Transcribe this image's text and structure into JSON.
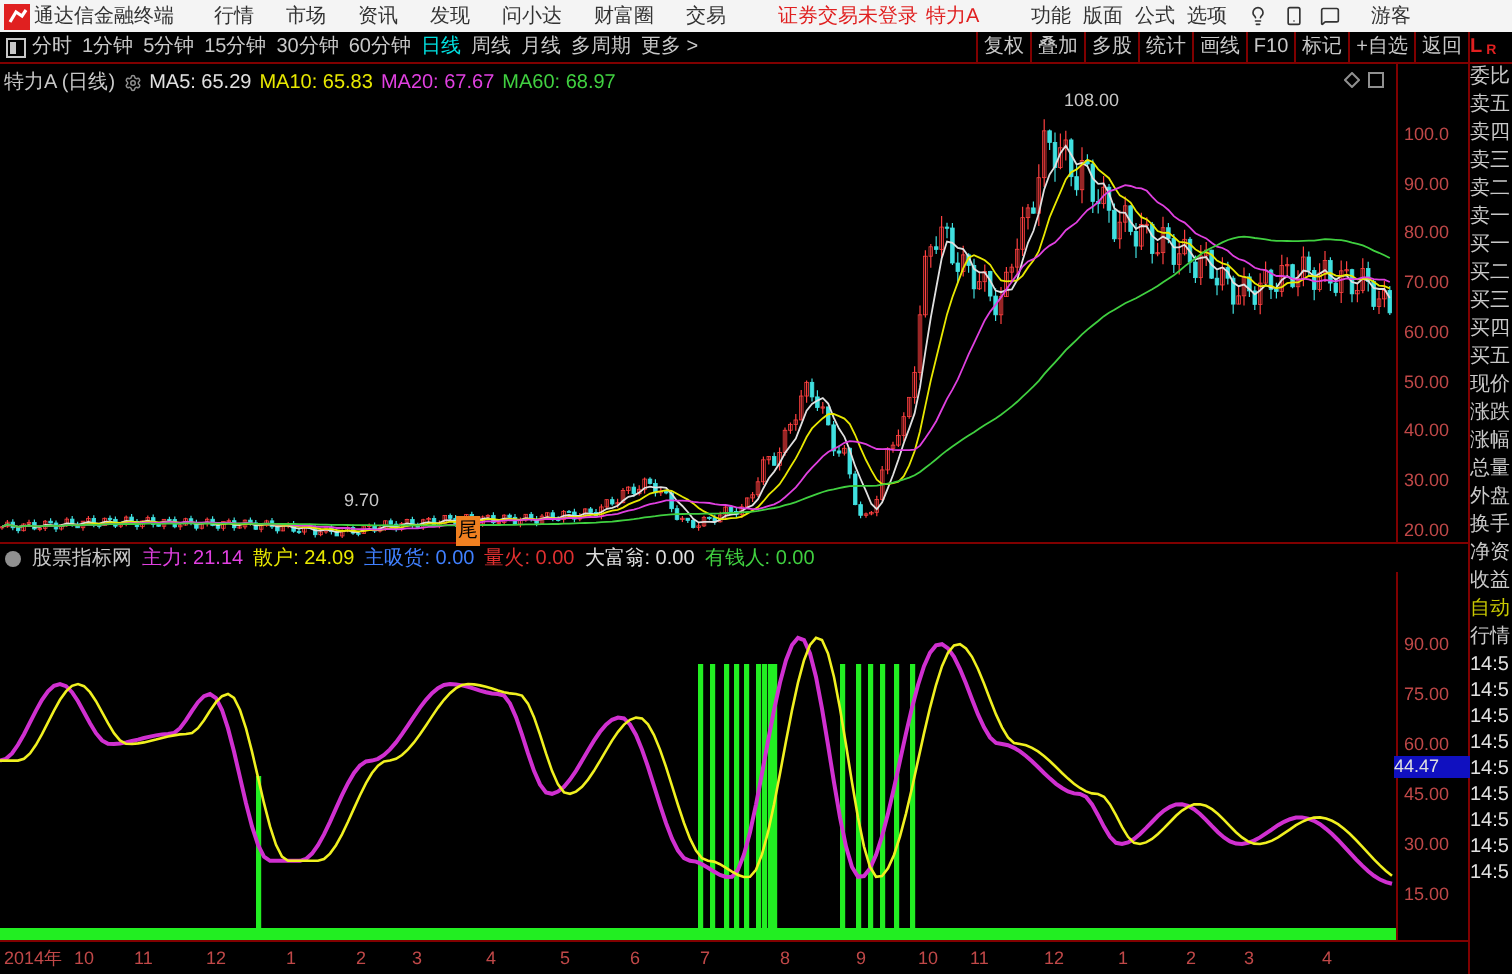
{
  "menu_bar": {
    "app_title": "通达信金融终端",
    "menus": [
      "行情",
      "市场",
      "资讯",
      "发现",
      "问小达",
      "财富圈",
      "交易"
    ],
    "login_status": "证券交易未登录",
    "stock": "特力A",
    "tools": [
      "功能",
      "版面",
      "公式",
      "选项"
    ],
    "user": "游客"
  },
  "period_tabs": [
    {
      "label": "分时",
      "selected": false
    },
    {
      "label": "1分钟",
      "selected": false
    },
    {
      "label": "5分钟",
      "selected": false
    },
    {
      "label": "15分钟",
      "selected": false
    },
    {
      "label": "30分钟",
      "selected": false
    },
    {
      "label": "60分钟",
      "selected": false
    },
    {
      "label": "日线",
      "selected": true
    },
    {
      "label": "周线",
      "selected": false
    },
    {
      "label": "月线",
      "selected": false
    },
    {
      "label": "多周期",
      "selected": false
    },
    {
      "label": "更多 >",
      "selected": false
    }
  ],
  "chart_tools": [
    "复权",
    "叠加",
    "多股",
    "统计",
    "画线",
    "F10",
    "标记",
    "+自选",
    "返回"
  ],
  "main_chart": {
    "title": "特力A (日线)",
    "indicators": [
      {
        "label": "MA5: 65.29",
        "color": "#e0e0e0"
      },
      {
        "label": "MA10: 65.83",
        "color": "#e8e800"
      },
      {
        "label": "MA20: 67.67",
        "color": "#e040e0"
      },
      {
        "label": "MA60: 68.97",
        "color": "#40d040"
      }
    ],
    "high_label": "108.00",
    "low_label": "9.70",
    "marker": "尾",
    "price_axis": [
      "100.0",
      "90.00",
      "80.00",
      "70.00",
      "60.00",
      "50.00",
      "40.00",
      "30.00",
      "20.00"
    ]
  },
  "indicator_panel": {
    "title": "股票指标网",
    "values": [
      {
        "label": "主力: 21.14",
        "color": "#e040e0"
      },
      {
        "label": "散户: 24.09",
        "color": "#e8e800"
      },
      {
        "label": "主吸货: 0.00",
        "color": "#4080ff"
      },
      {
        "label": "量火: 0.00",
        "color": "#e03030"
      },
      {
        "label": "大富翁: 0.00",
        "color": "#e0e0e0"
      },
      {
        "label": "有钱人: 0.00",
        "color": "#40d040"
      }
    ],
    "axis": [
      "90.00",
      "75.00",
      "60.00",
      "45.00",
      "30.00",
      "15.00"
    ],
    "current_value": "44.47"
  },
  "time_axis": [
    "2014年",
    "10",
    "11",
    "12",
    "1",
    "2",
    "3",
    "4",
    "5",
    "6",
    "7",
    "8",
    "9",
    "10",
    "11",
    "12",
    "1",
    "2",
    "3",
    "4"
  ],
  "side_panel": {
    "header": [
      "L",
      "R"
    ],
    "rows": [
      {
        "label": "委比",
        "kind": "field"
      },
      {
        "label": "卖五",
        "kind": "field"
      },
      {
        "label": "卖四",
        "kind": "field"
      },
      {
        "label": "卖三",
        "kind": "field"
      },
      {
        "label": "卖二",
        "kind": "field"
      },
      {
        "label": "卖一",
        "kind": "field"
      },
      {
        "label": "买一",
        "kind": "field"
      },
      {
        "label": "买二",
        "kind": "field"
      },
      {
        "label": "买三",
        "kind": "field"
      },
      {
        "label": "买四",
        "kind": "field"
      },
      {
        "label": "买五",
        "kind": "field"
      },
      {
        "label": "现价",
        "kind": "field"
      },
      {
        "label": "涨跌",
        "kind": "field"
      },
      {
        "label": "涨幅",
        "kind": "field"
      },
      {
        "label": "总量",
        "kind": "field"
      },
      {
        "label": "外盘",
        "kind": "field"
      },
      {
        "label": "换手",
        "kind": "field"
      },
      {
        "label": "净资",
        "kind": "field"
      },
      {
        "label": "收益",
        "kind": "field"
      },
      {
        "label": "自动",
        "kind": "mode"
      },
      {
        "label": "行情",
        "kind": "field"
      },
      {
        "label": "14:5",
        "kind": "time"
      },
      {
        "label": "14:5",
        "kind": "time"
      },
      {
        "label": "14:5",
        "kind": "time"
      },
      {
        "label": "14:5",
        "kind": "time"
      },
      {
        "label": "14:5",
        "kind": "time"
      },
      {
        "label": "14:5",
        "kind": "time"
      },
      {
        "label": "14:5",
        "kind": "time"
      },
      {
        "label": "14:5",
        "kind": "time"
      },
      {
        "label": "14:5",
        "kind": "time"
      }
    ]
  }
}
